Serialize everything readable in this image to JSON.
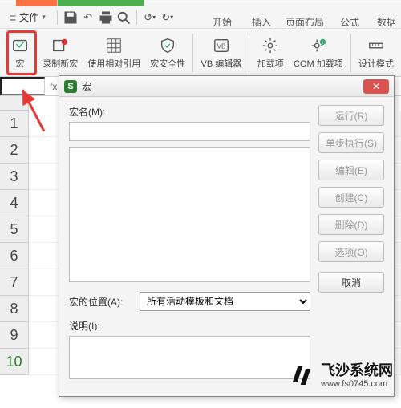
{
  "qat": {
    "file_label": "文件"
  },
  "menu_tabs": [
    "开始",
    "插入",
    "页面布局",
    "公式",
    "数据"
  ],
  "ribbon": {
    "macro": "宏",
    "record_macro": "录制新宏",
    "relative_ref": "使用相对引用",
    "macro_security": "宏安全性",
    "vb_editor": "VB 编辑器",
    "addins": "加载项",
    "com_addins": "COM 加载项",
    "design_mode": "设计模式"
  },
  "formula": {
    "cell": "",
    "fx": "fx"
  },
  "rows": [
    "1",
    "2",
    "3",
    "4",
    "5",
    "6",
    "7",
    "8",
    "9",
    "10"
  ],
  "dialog": {
    "title": "宏",
    "macro_name_label": "宏名(M):",
    "macro_location_label": "宏的位置(A):",
    "location_value": "所有活动模板和文档",
    "description_label": "说明(I):",
    "buttons": {
      "run": "运行(R)",
      "step": "单步执行(S)",
      "edit": "编辑(E)",
      "create": "创建(C)",
      "delete": "删除(D)",
      "options": "选项(O)",
      "cancel": "取消"
    }
  },
  "watermark": {
    "title": "飞沙系统网",
    "url": "www.fs0745.com"
  }
}
